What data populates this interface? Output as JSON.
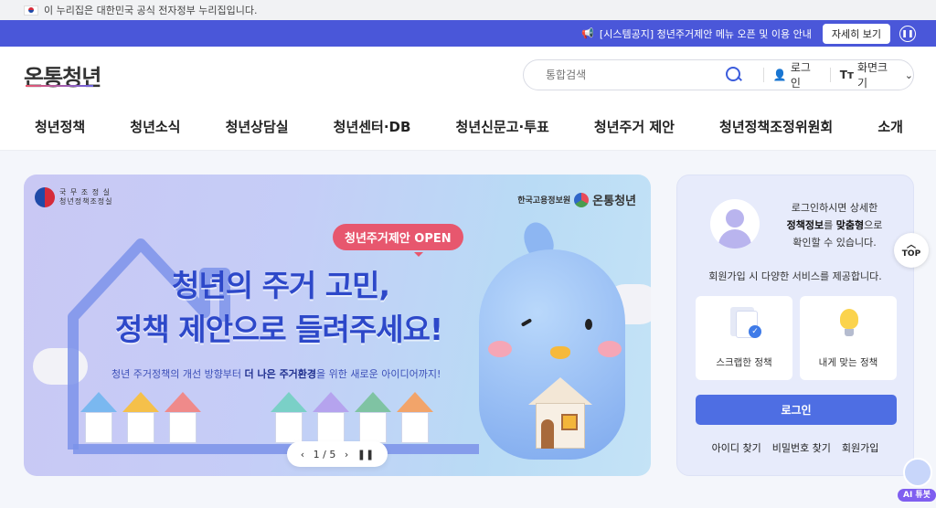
{
  "gov_bar": {
    "text": "이 누리집은 대한민국 공식 전자정부 누리집입니다."
  },
  "notice": {
    "text": "[시스템공지] 청년주거제안 메뉴 오픈 및 이용 안내",
    "more_label": "자세히 보기",
    "pause_icon": "pause-icon"
  },
  "header": {
    "logo_text": "온통청년",
    "search_placeholder": "통합검색",
    "login_label": "로그인",
    "screen_size_label": "화면크기"
  },
  "nav": {
    "items": [
      "청년정책",
      "청년소식",
      "청년상담실",
      "청년센터·DB",
      "청년신문고·투표",
      "청년주거 제안",
      "청년정책조정위원회",
      "소개"
    ]
  },
  "banner": {
    "emblem_line1": "국 무 조 정 실",
    "emblem_line2": "청년정책조정실",
    "partner1": "한국고용정보원",
    "partner2": "온통청년",
    "tag": "청년주거제안 OPEN",
    "headline1": "청년의 주거 고민,",
    "headline2": "정책 제안으로 들려주세요!",
    "sub_a": "청년 주거정책의 개선 방향부터 ",
    "sub_b": "더 나은 주거환경",
    "sub_c": "을 위한 새로운 아이디어까지!",
    "pager_current": "1",
    "pager_sep": "/",
    "pager_total": "5"
  },
  "login_card": {
    "msg_line1": "로그인하시면 상세한",
    "msg_b1": "정책정보",
    "msg_mid": "를 ",
    "msg_b2": "맞춤형",
    "msg_end": "으로",
    "msg_line3": "확인할 수 있습니다.",
    "signup_msg": "회원가입 시 다양한 서비스를 제공합니다.",
    "tile1": "스크랩한 정책",
    "tile2": "내게 맞는 정책",
    "login_button": "로그인",
    "find_id": "아이디 찾기",
    "find_pw": "비밀번호 찾기",
    "signup": "회원가입"
  },
  "top_button": "TOP",
  "ai_button": "AI 튜봇",
  "colors": {
    "accent": "#4a57d9",
    "login_btn": "#4e6ee3",
    "tag": "#e7576e",
    "headline": "#2d48c9"
  }
}
